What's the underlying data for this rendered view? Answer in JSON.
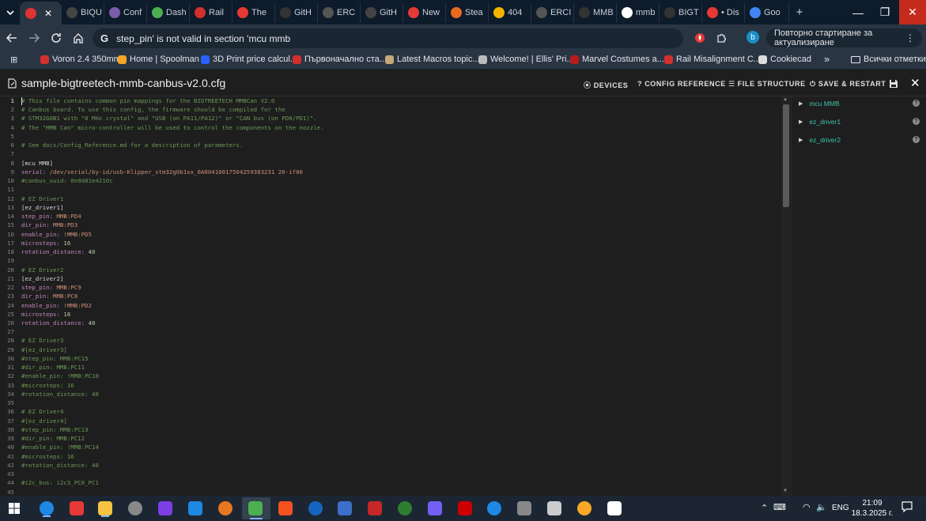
{
  "tabs": [
    {
      "label": "",
      "fav": "#d33",
      "active": true
    },
    {
      "label": "BIQU",
      "fav": "#444"
    },
    {
      "label": "Conf",
      "fav": "#7a5ca8"
    },
    {
      "label": "Dash",
      "fav": "#4caf50"
    },
    {
      "label": "Rail",
      "fav": "#d32f2f"
    },
    {
      "label": "The",
      "fav": "#e53935"
    },
    {
      "label": "GitH",
      "fav": "#333"
    },
    {
      "label": "ERC",
      "fav": "#555"
    },
    {
      "label": "GitH",
      "fav": "#444"
    },
    {
      "label": "New",
      "fav": "#e53935"
    },
    {
      "label": "Stea",
      "fav": "#e86a1f"
    },
    {
      "label": "404",
      "fav": "#f4b400"
    },
    {
      "label": "ERCI",
      "fav": "#555"
    },
    {
      "label": "MMB",
      "fav": "#333"
    },
    {
      "label": "mmb",
      "fav": "#fff"
    },
    {
      "label": "BIGT",
      "fav": "#333"
    },
    {
      "label": "• Dis",
      "fav": "#e53935"
    },
    {
      "label": "Goo",
      "fav": "#4285f4"
    }
  ],
  "window": {
    "minimize": "—",
    "restore": "❐",
    "close": "✕",
    "new_tab": "+"
  },
  "omnibox": {
    "text": "step_pin' is not valid in section 'mcu mmb"
  },
  "relaunch_label": "Повторно стартиране за актуализиране",
  "profile_initial": "b",
  "bookmarks": [
    {
      "label": "Voron 2.4 350mm",
      "fav": "#d32f2f"
    },
    {
      "label": "Home | Spoolman",
      "fav": "#f5a623"
    },
    {
      "label": "3D Print price calcul...",
      "fav": "#2962ff"
    },
    {
      "label": "Първоначално ста...",
      "fav": "#d32f2f"
    },
    {
      "label": "Latest Macros topic...",
      "fav": "#c8a878"
    },
    {
      "label": "Welcome! | Ellis' Pri...",
      "fav": "#bbb"
    },
    {
      "label": "Marvel Costumes a...",
      "fav": "#b71c1c"
    },
    {
      "label": "Rail Misalignment C...",
      "fav": "#d32f2f"
    },
    {
      "label": "Cookiecad",
      "fav": "#ddd"
    }
  ],
  "bookmarks_more": "»",
  "all_bookmarks": "Всички отметки",
  "editor": {
    "filename": "sample-bigtreetech-mmb-canbus-v2.0.cfg",
    "buttons": [
      "DEVICES",
      "CONFIG REFERENCE",
      "FILE STRUCTURE",
      "SAVE & RESTART"
    ],
    "lines": [
      [
        [
          "c-cmt",
          "# This file contains common pin mappings for the BIGTREETECH MMBCan V2.0"
        ]
      ],
      [
        [
          "c-cmt",
          "# Canbus board. To use this config, the firmware should be compiled for the"
        ]
      ],
      [
        [
          "c-cmt",
          "# STM32G0B1 with \"8 MHz crystal\" and \"USB (on PA11/PA12)\" or \"CAN bus (on PD0/PD1)\"."
        ]
      ],
      [
        [
          "c-cmt",
          "# The \"MMB Can\" micro-controller will be used to control the components on the nozzle."
        ]
      ],
      [],
      [
        [
          "c-cmt",
          "# See docs/Config_Reference.md for a description of parameters."
        ]
      ],
      [],
      [
        [
          "c-sec",
          "[mcu MMB]"
        ]
      ],
      [
        [
          "c-key",
          "serial: "
        ],
        [
          "c-val",
          "/dev/serial/by-id/usb-Klipper_stm32g0b1xx_0A00410017504259383231 20-if00"
        ]
      ],
      [
        [
          "c-cmt",
          "#canbus_uuid: 0e0d81e4210c"
        ]
      ],
      [],
      [
        [
          "c-cmt",
          "# EZ Driver1"
        ]
      ],
      [
        [
          "c-sec",
          "[ez_driver1]"
        ]
      ],
      [
        [
          "c-key",
          "step_pin: "
        ],
        [
          "c-val",
          "MMB:PD4"
        ]
      ],
      [
        [
          "c-key",
          "dir_pin: "
        ],
        [
          "c-val",
          "MMB:PD3"
        ]
      ],
      [
        [
          "c-key",
          "enable_pin: "
        ],
        [
          "c-val",
          "!MMB:PD5"
        ]
      ],
      [
        [
          "c-key",
          "microsteps: "
        ],
        [
          "c-num",
          "16"
        ]
      ],
      [
        [
          "c-key",
          "rotation_distance: "
        ],
        [
          "c-num",
          "40"
        ]
      ],
      [],
      [
        [
          "c-cmt",
          "# EZ Driver2"
        ]
      ],
      [
        [
          "c-sec",
          "[ez_driver2]"
        ]
      ],
      [
        [
          "c-key",
          "step_pin: "
        ],
        [
          "c-val",
          "MMB:PC9"
        ]
      ],
      [
        [
          "c-key",
          "dir_pin: "
        ],
        [
          "c-val",
          "MMB:PC8"
        ]
      ],
      [
        [
          "c-key",
          "enable_pin: "
        ],
        [
          "c-val",
          "!MMB:PD2"
        ]
      ],
      [
        [
          "c-key",
          "microsteps: "
        ],
        [
          "c-num",
          "16"
        ]
      ],
      [
        [
          "c-key",
          "rotation_distance: "
        ],
        [
          "c-num",
          "40"
        ]
      ],
      [],
      [
        [
          "c-cmt",
          "# EZ Driver3"
        ]
      ],
      [
        [
          "c-cmt",
          "#[ez_driver3]"
        ]
      ],
      [
        [
          "c-cmt",
          "#step_pin: MMB:PC15"
        ]
      ],
      [
        [
          "c-cmt",
          "#dir_pin: MMB:PC11"
        ]
      ],
      [
        [
          "c-cmt",
          "#enable_pin: !MMB:PC10"
        ]
      ],
      [
        [
          "c-cmt",
          "#microsteps: 16"
        ]
      ],
      [
        [
          "c-cmt",
          "#rotation_distance: 40"
        ]
      ],
      [],
      [
        [
          "c-cmt",
          "# EZ Driver4"
        ]
      ],
      [
        [
          "c-cmt",
          "#[ez_driver4]"
        ]
      ],
      [
        [
          "c-cmt",
          "#step_pin: MMB:PC13"
        ]
      ],
      [
        [
          "c-cmt",
          "#dir_pin: MMB:PC12"
        ]
      ],
      [
        [
          "c-cmt",
          "#enable_pin: !MMB:PC14"
        ]
      ],
      [
        [
          "c-cmt",
          "#microsteps: 16"
        ]
      ],
      [
        [
          "c-cmt",
          "#rotation_distance: 40"
        ]
      ],
      [],
      [
        [
          "c-cmt",
          "#i2c_bus: i2c3_PC0_PC1"
        ]
      ],
      []
    ]
  },
  "structure": [
    {
      "label": "mcu MMB",
      "help": "?"
    },
    {
      "label": "ez_driver1",
      "help": "?"
    },
    {
      "label": "ez_driver2",
      "help": "?"
    }
  ],
  "taskbar": {
    "apps": [
      "#1e88e5",
      "#e53935",
      "#f6c343",
      "#888",
      "#7b3fe4",
      "#1e88e5",
      "#e87722",
      "#4caf50",
      "#f4511e",
      "#1565c0",
      "#3d6ec9",
      "#c62828",
      "#2e7d32",
      "#7360f2",
      "#cc0000",
      "#1e88e5",
      "#888",
      "#ccc",
      "#f9a825",
      "#fff"
    ],
    "lang": "ENG",
    "time": "21:09",
    "date": "18.3.2025 г."
  }
}
